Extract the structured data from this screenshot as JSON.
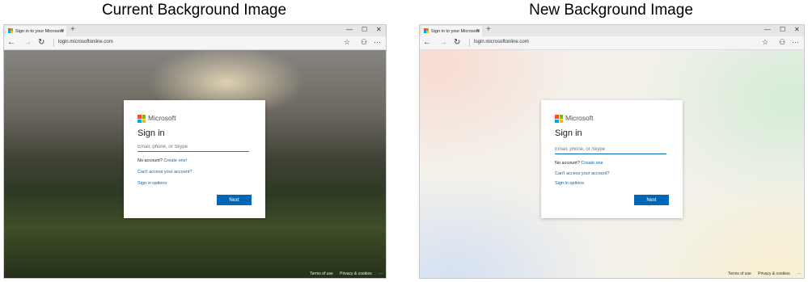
{
  "captions": {
    "current": "Current Background Image",
    "new": "New Background Image"
  },
  "browser": {
    "tab_title": "Sign in to your Microsoft",
    "tab_close": "✕",
    "new_tab": "+",
    "url": "login.microsoftonline.com",
    "window_buttons": {
      "minimize": "—",
      "maximize": "☐",
      "close": "✕"
    },
    "nav_icons": {
      "back": "←",
      "forward": "→",
      "refresh": "↻"
    },
    "tool_icons": {
      "favorites": "☆",
      "share": "⚇",
      "more": "···"
    }
  },
  "signin": {
    "brand": "Microsoft",
    "heading": "Sign in",
    "email_placeholder": "Email, phone, or Skype",
    "no_account": "No account?",
    "create_one_left": "Create one!",
    "create_one_right": "Create one",
    "cant_access": "Can't access your account?",
    "signin_options": "Sign in options",
    "next": "Next"
  },
  "footer": {
    "terms": "Terms of use",
    "privacy": "Privacy & cookies",
    "more": "···"
  },
  "colors": {
    "accent": "#0067b8",
    "ms_red": "#f25022",
    "ms_green": "#7fba00",
    "ms_blue": "#00a4ef",
    "ms_yellow": "#ffb900"
  }
}
